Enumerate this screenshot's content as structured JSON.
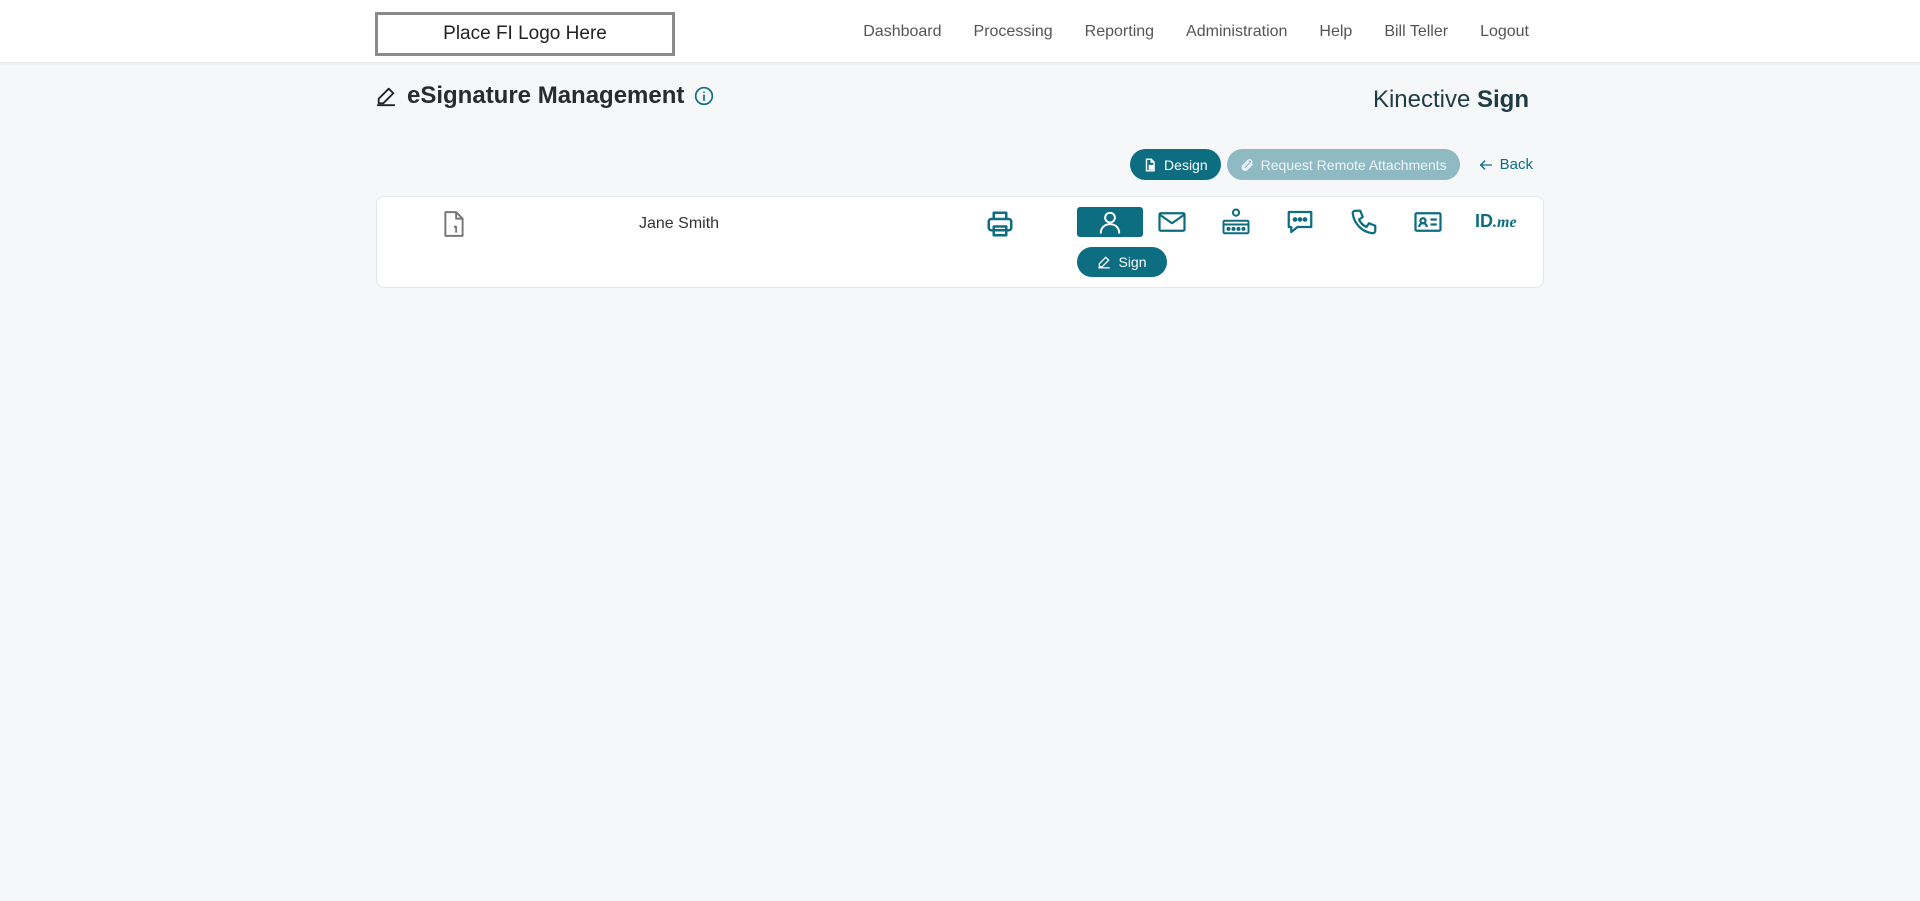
{
  "header": {
    "logo_text": "Place FI Logo Here",
    "nav": [
      "Dashboard",
      "Processing",
      "Reporting",
      "Administration",
      "Help",
      "Bill Teller",
      "Logout"
    ]
  },
  "page": {
    "title": "eSignature Management",
    "title_icon": "pen-icon",
    "info_icon": "info-icon",
    "brand_light": "Kinective ",
    "brand_bold": "Sign"
  },
  "actions": {
    "design_label": "Design",
    "remote_attachments_label": "Request Remote Attachments",
    "back_label": "Back"
  },
  "signer": {
    "name": "Jane Smith",
    "doc_icon": "document-icon",
    "print_icon": "printer-icon",
    "methods": [
      "in-person",
      "email",
      "password",
      "sms",
      "phone",
      "id-card",
      "id-me"
    ],
    "idme_id": "ID",
    "idme_me": ".me",
    "sign_label": "Sign"
  },
  "colors": {
    "accent": "#0d6e82",
    "disabled": "#8fbac4",
    "background": "#f5f7f9"
  }
}
